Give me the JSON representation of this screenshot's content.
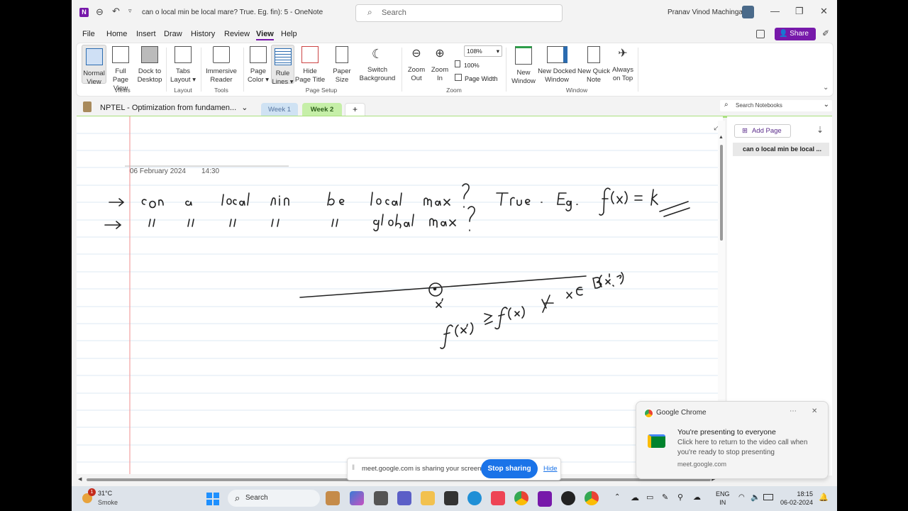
{
  "titlebar": {
    "doc_title": "can o local min be local mare? True. Eg. fin): 5",
    "app_name": "OneNote",
    "search_placeholder": "Search",
    "user_name": "Pranav Vinod Machingal"
  },
  "menu": [
    "File",
    "Home",
    "Insert",
    "Draw",
    "History",
    "Review",
    "View",
    "Help"
  ],
  "share_label": "Share",
  "ribbon": {
    "normal_view": [
      "Normal",
      "View"
    ],
    "full_page_view": [
      "Full Page",
      "View"
    ],
    "dock_desktop": [
      "Dock to",
      "Desktop"
    ],
    "views_group": "Views",
    "tabs_layout": [
      "Tabs",
      "Layout ▾"
    ],
    "layout_group": "Layout",
    "immersive_reader": [
      "Immersive",
      "Reader"
    ],
    "tools_group": "Tools",
    "page_color": [
      "Page",
      "Color ▾"
    ],
    "rule_lines": [
      "Rule",
      "Lines ▾"
    ],
    "hide_page_title": [
      "Hide",
      "Page Title"
    ],
    "paper_size": [
      "Paper",
      "Size"
    ],
    "switch_background": [
      "Switch",
      "Background"
    ],
    "page_setup_group": "Page Setup",
    "zoom_out": [
      "Zoom",
      "Out"
    ],
    "zoom_in": [
      "Zoom",
      "In"
    ],
    "zoom_value": "108%",
    "zoom_100": "100%",
    "page_width": "Page Width",
    "zoom_group": "Zoom",
    "new_window": [
      "New",
      "Window"
    ],
    "new_docked_window": [
      "New Docked",
      "Window"
    ],
    "new_quick_note": [
      "New Quick",
      "Note"
    ],
    "always_on_top": [
      "Always",
      "on Top"
    ],
    "window_group": "Window"
  },
  "notebook": {
    "name": "NPTEL - Optimization from fundamen...",
    "tabs": [
      "Week 1",
      "Week 2"
    ],
    "add_tab": "+",
    "search_placeholder": "Search Notebooks"
  },
  "page": {
    "date": "06 February 2024",
    "time": "14:30"
  },
  "sidepanel": {
    "add_page": "Add Page",
    "pages": [
      "can o local min be local ..."
    ]
  },
  "chrome_toast": {
    "app": "Google Chrome",
    "title": "You're presenting to everyone",
    "body": "Click here to return to the video call when you're ready to stop presenting",
    "source": "meet.google.com"
  },
  "share_bar": {
    "message": "meet.google.com is sharing your screen.",
    "stop_button": "Stop sharing",
    "hide": "Hide"
  },
  "taskbar": {
    "weather_temp": "31°C",
    "weather_desc": "Smoke",
    "search_label": "Search",
    "notification_count": "1",
    "lang_top": "ENG",
    "lang_bottom": "IN",
    "time": "18:15",
    "date": "06-02-2024"
  },
  "colors": {
    "accent_purple": "#7719aa",
    "tab_week1": "#cfe2f3",
    "tab_week2": "#c6efa8",
    "margin_red": "#f3a0a0",
    "rule_blue": "#dde9f3",
    "stop_blue": "#1a73e8"
  }
}
